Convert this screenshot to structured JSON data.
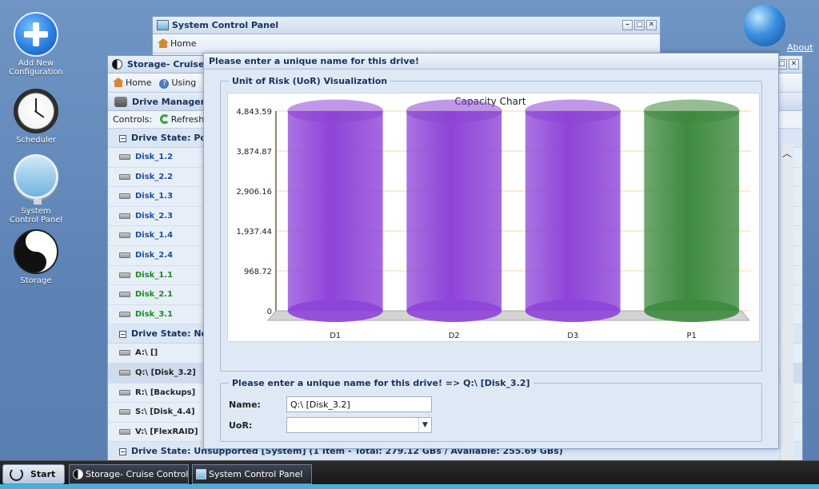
{
  "desktop": {
    "icons": [
      {
        "label_line1": "Add New",
        "label_line2": "Configuration"
      },
      {
        "label_line1": "Scheduler",
        "label_line2": ""
      },
      {
        "label_line1": "System",
        "label_line2": "Control Panel"
      },
      {
        "label_line1": "Storage",
        "label_line2": ""
      }
    ],
    "about_label": "About"
  },
  "system_window": {
    "title": "System Control Panel",
    "home_label": "Home"
  },
  "storage_window": {
    "title": "Storage- Cruise Co",
    "home_label": "Home",
    "using_label": "Using",
    "drive_manager_label": "Drive Manager",
    "controls_label": "Controls:",
    "refresh_label": "Refresh",
    "group_pool_label": "Drive State: Pool",
    "pool_disks": [
      {
        "name": "Disk_1.2",
        "color": "#1b4f9c"
      },
      {
        "name": "Disk_2.2",
        "color": "#1b4f9c"
      },
      {
        "name": "Disk_1.3",
        "color": "#1b4f9c"
      },
      {
        "name": "Disk_2.3",
        "color": "#1b4f9c"
      },
      {
        "name": "Disk_1.4",
        "color": "#1b4f9c"
      },
      {
        "name": "Disk_2.4",
        "color": "#1b4f9c"
      },
      {
        "name": "Disk_1.1",
        "color": "#1c8a1c"
      },
      {
        "name": "Disk_2.1",
        "color": "#1c8a1c"
      },
      {
        "name": "Disk_3.1",
        "color": "#1c8a1c"
      }
    ],
    "group_not_label": "Drive State: Not",
    "not_disks": [
      {
        "name": "A:\\ []"
      },
      {
        "name": "Q:\\ [Disk_3.2]"
      },
      {
        "name": "R:\\ [Backups]"
      },
      {
        "name": "S:\\ [Disk_4.4]"
      },
      {
        "name": "V:\\ [FlexRAID]"
      }
    ],
    "group_unsupported_label": "Drive State: Unsupported [System] (1 Item - Total: 279.12 GBs / Available: 255.69 GBs)"
  },
  "dialog": {
    "title": "Please enter a unique name for this drive!",
    "viz_legend": "Unit of Risk (UoR) Visualization",
    "form_legend": "Please enter a unique name for this drive! => Q:\\ [Disk_3.2]",
    "name_label": "Name:",
    "name_value": "Q:\\ [Disk_3.2]",
    "uor_label": "UoR:",
    "uor_value": ""
  },
  "chart_data": {
    "type": "bar",
    "title": "Capacity Chart",
    "categories": [
      "D1",
      "D2",
      "D3",
      "P1"
    ],
    "values": [
      4843.59,
      4843.59,
      4843.59,
      4843.59
    ],
    "bar_colors": [
      "#8e44d8",
      "#8e44d8",
      "#8e44d8",
      "#3f8a3f"
    ],
    "ylim": [
      0,
      4843.59
    ],
    "yticks": [
      0,
      968.72,
      1937.44,
      2906.16,
      3874.87,
      4843.59
    ],
    "ytick_labels": [
      "0",
      "968.72",
      "1,937.44",
      "2,906.16",
      "3,874.87",
      "4,843.59"
    ],
    "xlabel": "",
    "ylabel": "",
    "grid": true
  },
  "taskbar": {
    "start_label": "Start",
    "tasks": [
      {
        "label": "Storage- Cruise Control..."
      },
      {
        "label": "System Control Panel"
      }
    ]
  }
}
